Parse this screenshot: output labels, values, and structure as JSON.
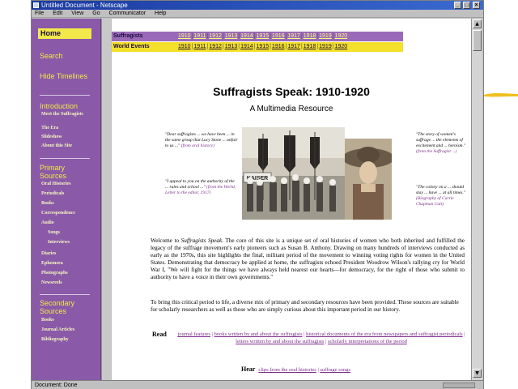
{
  "window": {
    "title": "Untitled Document - Netscape"
  },
  "menu": [
    "File",
    "Edit",
    "View",
    "Go",
    "Communicator",
    "Help"
  ],
  "sidebar": {
    "home": "Home",
    "search": "Search",
    "hide_timelines": "Hide Timelines",
    "introduction": {
      "heading": "Introduction",
      "items": [
        "Meet the Suffragists",
        "The Era",
        "Slideshow",
        "About this Site"
      ]
    },
    "primary_sources": {
      "heading": "Primary Sources",
      "items": [
        "Oral Histories",
        "Periodicals",
        "Books",
        "Correspondence",
        "Audio",
        "Songs",
        "Interviews",
        "Diaries",
        "Ephemera",
        "Photographs",
        "Newsreels"
      ]
    },
    "secondary_sources": {
      "heading": "Secondary Sources",
      "items": [
        "Books",
        "Journal Articles",
        "Bibliography"
      ]
    }
  },
  "timelines": {
    "suffragists": {
      "label": "Suffragists",
      "years": [
        "1910",
        "1911",
        "1912",
        "1913",
        "1914",
        "1915",
        "1916",
        "1917",
        "1918",
        "1919",
        "1920"
      ]
    },
    "world_events": {
      "label": "World Events",
      "years": [
        "1910",
        "1911",
        "1912",
        "1913",
        "1914",
        "1915",
        "1916",
        "1917",
        "1918",
        "1919",
        "1920"
      ]
    }
  },
  "page": {
    "title": "Suffragists Speak: 1910-1920",
    "subtitle": "A Multimedia Resource",
    "quotes": {
      "left_top": {
        "text": "\"Dear suffragists ... we have been ... in the same group that Lucy Stone ... unfair to us ...\"",
        "cite": "(from oral history)"
      },
      "left_bottom": {
        "text": "\"I appeal to you on the authority of the ... rules and school ...\"",
        "cite": "(from the World, Letter to the editor, 1917)"
      },
      "right_top": {
        "text": "\"The story of women's suffrage ... the elements of excitement and ... heroism.\"",
        "cite": "(from the Suffragist ...)"
      },
      "right_bottom": {
        "text": "\"The colony on a ... should stay ... have ... at all times.\"",
        "cite": "(Biography of Carrie Chapman Catt)"
      }
    },
    "photo_banner": "KAISER",
    "welcome": {
      "lead": "Welcome to ",
      "site_name": "Suffragists Speak",
      "body": ". The core of this site is a unique set of oral histories of women who both inherited and fulfilled the legacy of the suffrage movement's early pioneers such as Susan B. Anthony. Drawing on many hundreds of interviews conducted as early as the 1970s, this site highlights the final, militant period of the movement to winning voting rights for women in the United States. Demonstrating that democracy be applied at home, the suffragists echoed President Woodrow Wilson's rallying cry for World War I, \"We will fight for the things we have always held nearest our hearts—for democracy, for the right of those who submit to authority to have a voice in their own governments.\""
    },
    "bridge": "To bring this critical period to life, a diverse mix of primary and secondary resources have been provided. These sources are suitable for scholarly researchers as well as those who are simply curious about this important period in our history.",
    "read": {
      "verb": "Read",
      "links": [
        "journal features",
        "books written by and about the suffragists",
        "historical documents of the era from newspapers and suffragist periodicals",
        "letters written by and about the suffragists",
        "scholarly interpretations of the period"
      ]
    },
    "hear": {
      "verb": "Hear",
      "links": [
        "clips from the oral histories",
        "suffrage songs"
      ]
    }
  },
  "status": {
    "text": "Document: Done"
  },
  "colors": {
    "sidebar": "#8a5aa8",
    "accent_yellow": "#f2e94a",
    "link_purple": "#7a2a8a"
  }
}
